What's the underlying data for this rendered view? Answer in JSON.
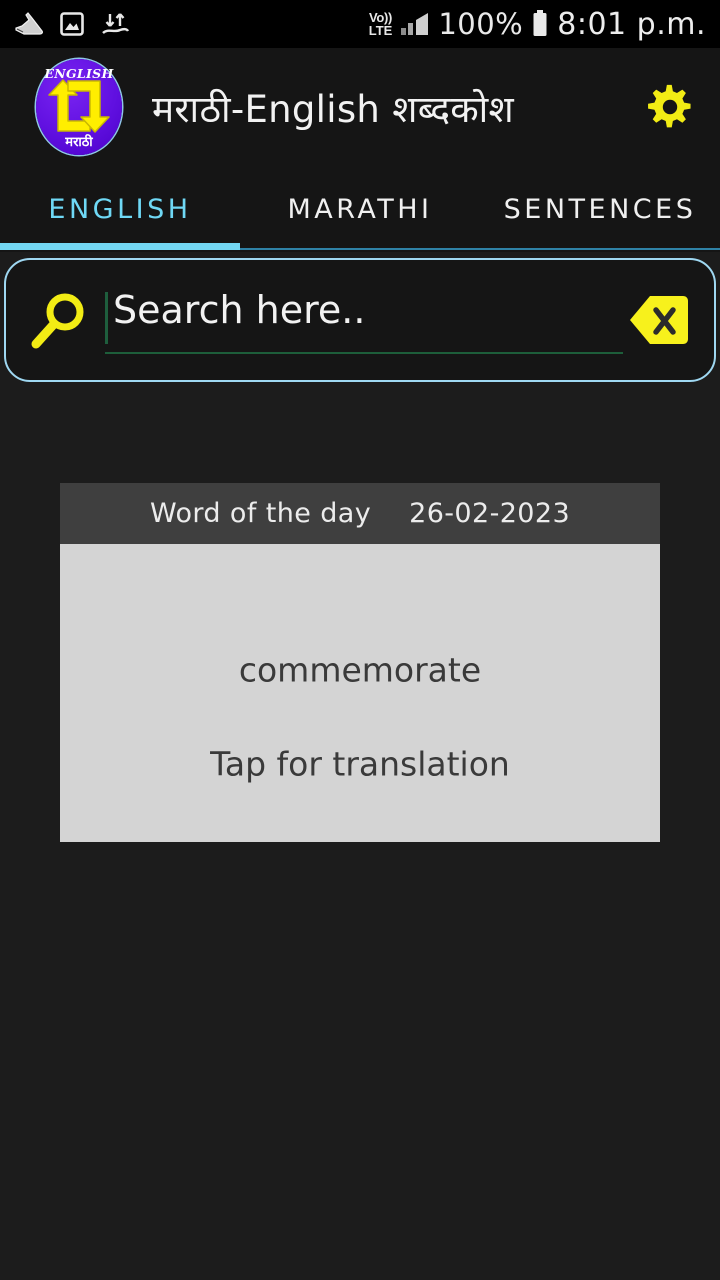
{
  "statusbar": {
    "left_icons": [
      "pedometer-shoe-icon",
      "photo-icon",
      "data-transfer-icon"
    ],
    "network_line1": "Vo))",
    "network_line2": "LTE",
    "signal_icon": "signal-bars-icon",
    "battery_percent": "100%",
    "battery_icon": "battery-full-icon",
    "time": "8:01 p.m."
  },
  "appbar": {
    "logo": {
      "top_label": "ENGLISH",
      "bottom_label": "मराठी",
      "icon": "two-way-arrows-icon"
    },
    "title": "मराठी-English शब्दकोश",
    "settings_icon": "gear-icon"
  },
  "tabs": {
    "items": [
      {
        "label": "ENGLISH",
        "active": true
      },
      {
        "label": "MARATHI",
        "active": false
      },
      {
        "label": "SENTENCES",
        "active": false
      }
    ],
    "active_color": "#6fd8f5",
    "inactive_color": "#f0f0f0",
    "indicator_color": "#73d7f2"
  },
  "search": {
    "search_icon": "search-icon",
    "placeholder": "Search here..",
    "value": "",
    "clear_icon": "clear-backspace-icon",
    "border_color": "#9fd8f2",
    "underline_color": "#1d5e3a"
  },
  "word_of_the_day": {
    "header_label": "Word of the day",
    "date": "26-02-2023",
    "word": "commemorate",
    "hint": "Tap for translation",
    "header_bg": "#3f3f3f",
    "body_bg": "#d4d4d4"
  },
  "theme": {
    "background": "#1c1c1c",
    "bar_background": "#151515",
    "accent_yellow": "#f2ec14",
    "accent_cyan": "#6fd8f5"
  }
}
